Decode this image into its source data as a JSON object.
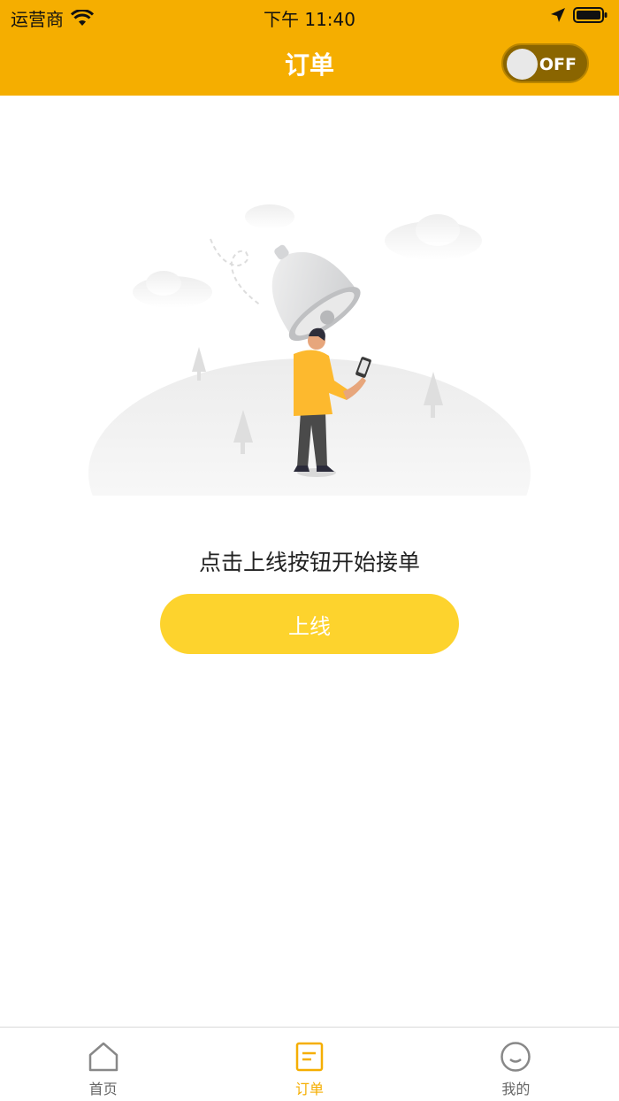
{
  "status_bar": {
    "carrier": "运营商",
    "time": "下午 11:40"
  },
  "nav": {
    "title": "订单",
    "toggle_label": "OFF"
  },
  "main": {
    "prompt": "点击上线按钮开始接单",
    "button_label": "上线"
  },
  "tabs": [
    {
      "label": "首页",
      "icon": "home-icon",
      "active": false
    },
    {
      "label": "订单",
      "icon": "order-icon",
      "active": true
    },
    {
      "label": "我的",
      "icon": "profile-icon",
      "active": false
    }
  ],
  "colors": {
    "header": "#f5ae00",
    "button": "#fdd32d",
    "active_tab": "#f5ae00"
  }
}
